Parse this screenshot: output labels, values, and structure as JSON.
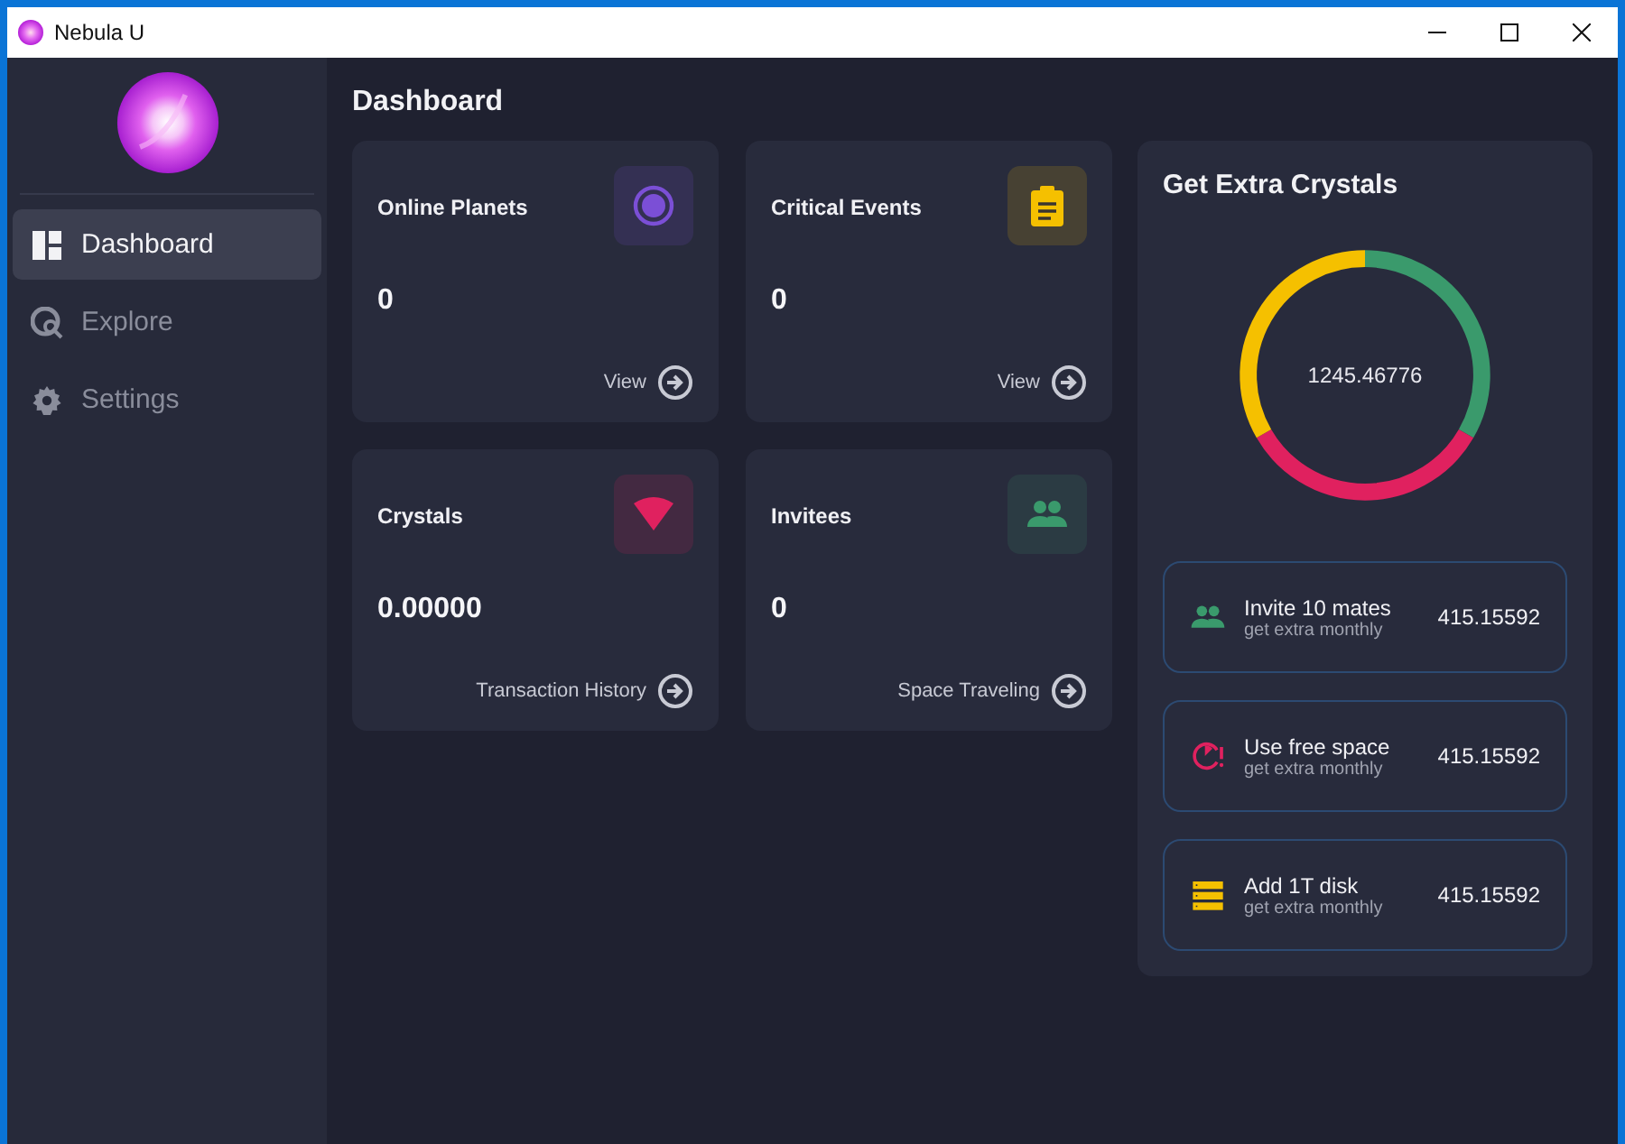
{
  "window": {
    "title": "Nebula U"
  },
  "sidebar": {
    "items": [
      {
        "label": "Dashboard",
        "kind": "dashboard",
        "selected": true
      },
      {
        "label": "Explore",
        "kind": "explore",
        "selected": false
      },
      {
        "label": "Settings",
        "kind": "settings",
        "selected": false
      }
    ]
  },
  "page": {
    "title": "Dashboard"
  },
  "cards": [
    {
      "title": "Online Planets",
      "value": "0",
      "link": "View",
      "kind": "planet",
      "color": "#7b4fd6"
    },
    {
      "title": "Critical Events",
      "value": "0",
      "link": "View",
      "kind": "clipboard",
      "color": "#f5c000"
    },
    {
      "title": "Crystals",
      "value": "0.00000",
      "link": "Transaction History",
      "kind": "wedge",
      "color": "#e0215f"
    },
    {
      "title": "Invitees",
      "value": "0",
      "link": "Space Traveling",
      "kind": "people",
      "color": "#3a9a6c"
    }
  ],
  "extra": {
    "title": "Get Extra Crystals",
    "total": "1245.46776",
    "rewards": [
      {
        "title": "Invite 10 mates",
        "subtitle": "get extra monthly",
        "value": "415.15592",
        "kind": "people",
        "color": "#3a9a6c"
      },
      {
        "title": "Use free space",
        "subtitle": "get extra monthly",
        "value": "415.15592",
        "kind": "timer",
        "color": "#e0215f"
      },
      {
        "title": "Add 1T disk",
        "subtitle": "get extra monthly",
        "value": "415.15592",
        "kind": "disk",
        "color": "#f5c000"
      }
    ]
  }
}
